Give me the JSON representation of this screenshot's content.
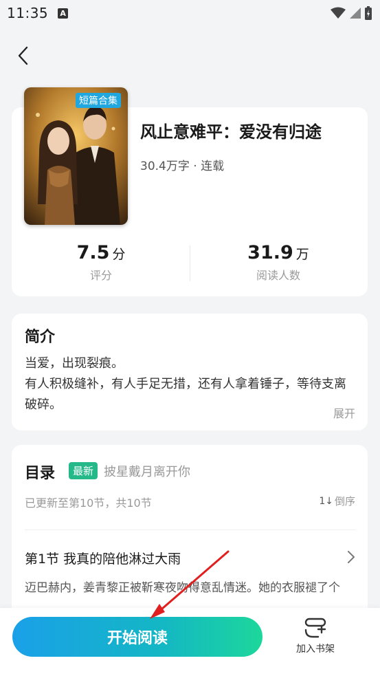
{
  "status_bar": {
    "time": "11:35",
    "app_icon_letter": "A"
  },
  "book": {
    "title": "风止意难平：爱没有归途",
    "meta": "30.4万字 · 连载",
    "cover_badge": "短篇合集",
    "rating": {
      "value": "7.5",
      "unit": "分",
      "label": "评分"
    },
    "readers": {
      "value": "31.9",
      "unit": "万",
      "label": "阅读人数"
    }
  },
  "intro": {
    "heading": "简介",
    "line1": "当爱，出现裂痕。",
    "line2": "有人积极缝补，有人手足无措，还有人拿着锤子，等待支离破碎。",
    "expand_label": "展开"
  },
  "toc": {
    "heading": "目录",
    "new_badge": "最新",
    "latest_chapter": "披星戴月离开你",
    "update_info": "已更新至第10节，共10节",
    "sort_label": "倒序",
    "sort_icon_text": "1↓",
    "chapter": {
      "title": "第1节 我真的陪他淋过大雨",
      "preview": "迈巴赫内，姜青黎正被靳寒夜吻得意乱情迷。她的衣服褪了个"
    }
  },
  "bottom": {
    "read_label": "开始阅读",
    "shelf_label": "加入书架"
  },
  "colors": {
    "accent_blue": "#1aa0e8",
    "accent_green": "#1dd79b",
    "badge_green": "#25b98a",
    "annotation_red": "#e02020"
  }
}
